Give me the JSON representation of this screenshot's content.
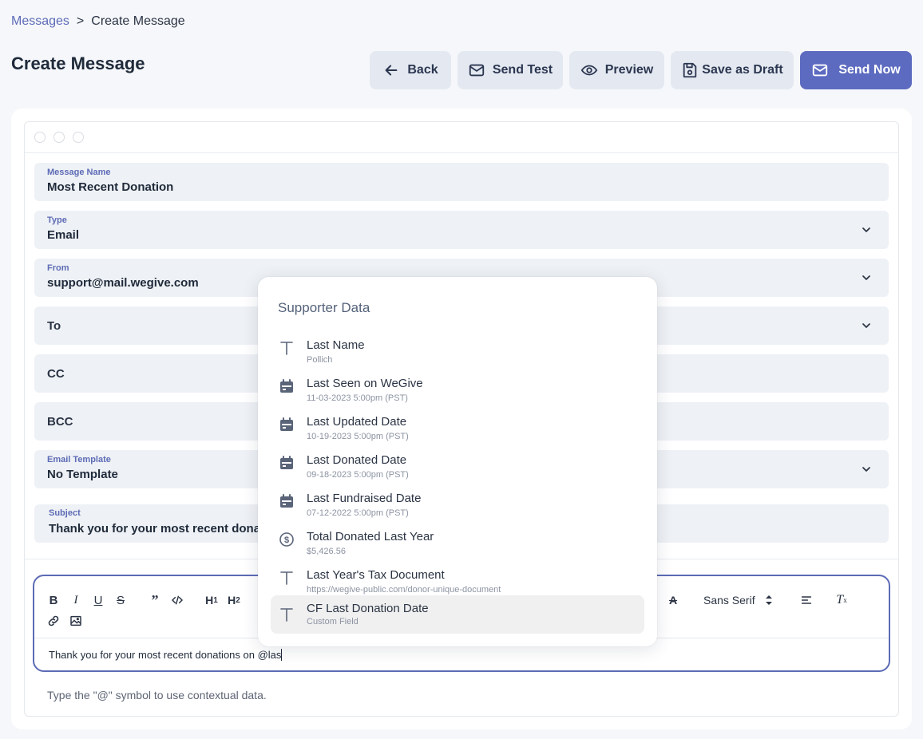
{
  "breadcrumb": {
    "parent": "Messages",
    "separator": ">",
    "current": "Create Message"
  },
  "page": {
    "title": "Create Message"
  },
  "toolbar": {
    "back": "Back",
    "send_test": "Send Test",
    "preview": "Preview",
    "save_draft": "Save as Draft",
    "send_now": "Send Now"
  },
  "form": {
    "message_name": {
      "label": "Message Name",
      "value": "Most Recent Donation"
    },
    "type": {
      "label": "Type",
      "value": "Email"
    },
    "from": {
      "label": "From",
      "value": "support@mail.wegive.com"
    },
    "to": {
      "placeholder": "To"
    },
    "cc": {
      "placeholder": "CC"
    },
    "bcc": {
      "placeholder": "BCC"
    },
    "email_template": {
      "label": "Email Template",
      "value": "No Template"
    },
    "subject": {
      "label": "Subject",
      "value": "Thank you for your most recent dona"
    }
  },
  "editor": {
    "font": "Sans Serif",
    "body_text": "Thank you for your most recent donations on @las",
    "hint": "Type the \"@\" symbol to use contextual data."
  },
  "supporter_data": {
    "title": "Supporter Data",
    "items": [
      {
        "icon": "text-icon",
        "title": "Last Name",
        "sub": "Pollich"
      },
      {
        "icon": "calendar-icon",
        "title": "Last Seen on WeGive",
        "sub": "11-03-2023 5:00pm (PST)"
      },
      {
        "icon": "calendar-icon",
        "title": "Last Updated Date",
        "sub": "10-19-2023 5:00pm (PST)"
      },
      {
        "icon": "calendar-icon",
        "title": "Last Donated Date",
        "sub": "09-18-2023 5:00pm (PST)"
      },
      {
        "icon": "calendar-icon",
        "title": "Last Fundraised Date",
        "sub": "07-12-2022 5:00pm (PST)"
      },
      {
        "icon": "dollar-icon",
        "title": "Total Donated Last Year",
        "sub": "$5,426.56"
      },
      {
        "icon": "text-icon",
        "title": "Last Year's Tax Document",
        "sub": "https://wegive-public.com/donor-unique-document"
      },
      {
        "icon": "text-icon",
        "title": "CF Last Donation Date",
        "sub": "Custom Field",
        "active": true
      }
    ]
  },
  "colors": {
    "accent": "#5c6bc0",
    "button_bg": "#e4e9f1",
    "field_bg": "#eef1f5",
    "label": "#5d6bb6"
  }
}
